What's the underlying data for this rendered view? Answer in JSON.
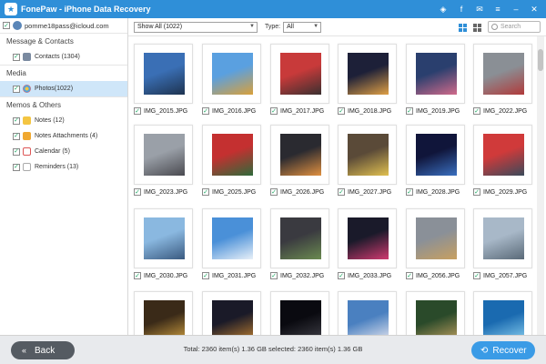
{
  "titlebar": {
    "app_name": "FonePaw - iPhone Data Recovery",
    "logo_glyph": "★"
  },
  "window_controls": [
    {
      "name": "diamond-icon",
      "glyph": "◈"
    },
    {
      "name": "facebook-icon",
      "glyph": "f"
    },
    {
      "name": "chat-icon",
      "glyph": "✉"
    },
    {
      "name": "menu-icon",
      "glyph": "≡"
    },
    {
      "name": "minimize-icon",
      "glyph": "–"
    },
    {
      "name": "close-icon",
      "glyph": "✕"
    }
  ],
  "sidebar": {
    "account": "pomme18pass@icloud.com",
    "sections": [
      {
        "label": "Message & Contacts",
        "items": [
          {
            "label": "Contacts (1304)",
            "icon": "contacts-icon",
            "cls": "ico-contacts",
            "selected": false
          }
        ]
      },
      {
        "label": "Media",
        "items": [
          {
            "label": "Photos(1022)",
            "icon": "photos-icon",
            "cls": "ico-photos",
            "selected": true
          }
        ]
      },
      {
        "label": "Memos & Others",
        "items": [
          {
            "label": "Notes (12)",
            "icon": "notes-icon",
            "cls": "ico-notes",
            "selected": false
          },
          {
            "label": "Notes Attachments (4)",
            "icon": "notes-attachments-icon",
            "cls": "ico-noteatt",
            "selected": false
          },
          {
            "label": "Calendar (5)",
            "icon": "calendar-icon",
            "cls": "ico-cal",
            "selected": false
          },
          {
            "label": "Reminders (13)",
            "icon": "reminders-icon",
            "cls": "ico-rem",
            "selected": false
          }
        ]
      }
    ]
  },
  "toolbar": {
    "filter_value": "Show All (1022)",
    "type_label": "Type:",
    "type_value": "All",
    "search_placeholder": "Search"
  },
  "photos": [
    {
      "name": "IMG_2015.JPG",
      "colors": [
        "#3a6fb5",
        "#1e3350"
      ]
    },
    {
      "name": "IMG_2016.JPG",
      "colors": [
        "#5aa0e0",
        "#d9a03a"
      ]
    },
    {
      "name": "IMG_2017.JPG",
      "colors": [
        "#c83a3a",
        "#3a3030"
      ]
    },
    {
      "name": "IMG_2018.JPG",
      "colors": [
        "#1d2038",
        "#e0a045"
      ]
    },
    {
      "name": "IMG_2019.JPG",
      "colors": [
        "#2a3f6e",
        "#d06a8a"
      ]
    },
    {
      "name": "IMG_2022.JPG",
      "colors": [
        "#8a8f95",
        "#b03a3a"
      ]
    },
    {
      "name": "IMG_2023.JPG",
      "colors": [
        "#9aa0a8",
        "#4a4a50"
      ]
    },
    {
      "name": "IMG_2025.JPG",
      "colors": [
        "#c43030",
        "#2e6a3a"
      ]
    },
    {
      "name": "IMG_2026.JPG",
      "colors": [
        "#2a2a30",
        "#e09040"
      ]
    },
    {
      "name": "IMG_2027.JPG",
      "colors": [
        "#5a4a38",
        "#e0c050"
      ]
    },
    {
      "name": "IMG_2028.JPG",
      "colors": [
        "#10153a",
        "#3a70c0"
      ]
    },
    {
      "name": "IMG_2029.JPG",
      "colors": [
        "#d03a3a",
        "#3a4a5a"
      ]
    },
    {
      "name": "IMG_2030.JPG",
      "colors": [
        "#8ab8e0",
        "#3a5a80"
      ]
    },
    {
      "name": "IMG_2031.JPG",
      "colors": [
        "#4a90d8",
        "#e8f0f8"
      ]
    },
    {
      "name": "IMG_2032.JPG",
      "colors": [
        "#3a3a40",
        "#6a8a50"
      ]
    },
    {
      "name": "IMG_2033.JPG",
      "colors": [
        "#1a1a2a",
        "#d03a70"
      ]
    },
    {
      "name": "IMG_2056.JPG",
      "colors": [
        "#8a9098",
        "#c8a060"
      ]
    },
    {
      "name": "IMG_2057.JPG",
      "colors": [
        "#a8b8c8",
        "#5a6a78"
      ]
    },
    {
      "name": "",
      "colors": [
        "#3a2a18",
        "#d0a040"
      ]
    },
    {
      "name": "",
      "colors": [
        "#1a1a28",
        "#c08030"
      ]
    },
    {
      "name": "",
      "colors": [
        "#0a0a10",
        "#404048"
      ]
    },
    {
      "name": "",
      "colors": [
        "#4a80c0",
        "#e8e8f0"
      ]
    },
    {
      "name": "",
      "colors": [
        "#2a4a2a",
        "#c0a060"
      ]
    },
    {
      "name": "",
      "colors": [
        "#1a6ab0",
        "#8ad0f0"
      ]
    }
  ],
  "footer": {
    "back_label": "Back",
    "summary": "Total: 2360 item(s) 1.36 GB    selected: 2360 item(s) 1.36 GB",
    "recover_label": "Recover"
  }
}
